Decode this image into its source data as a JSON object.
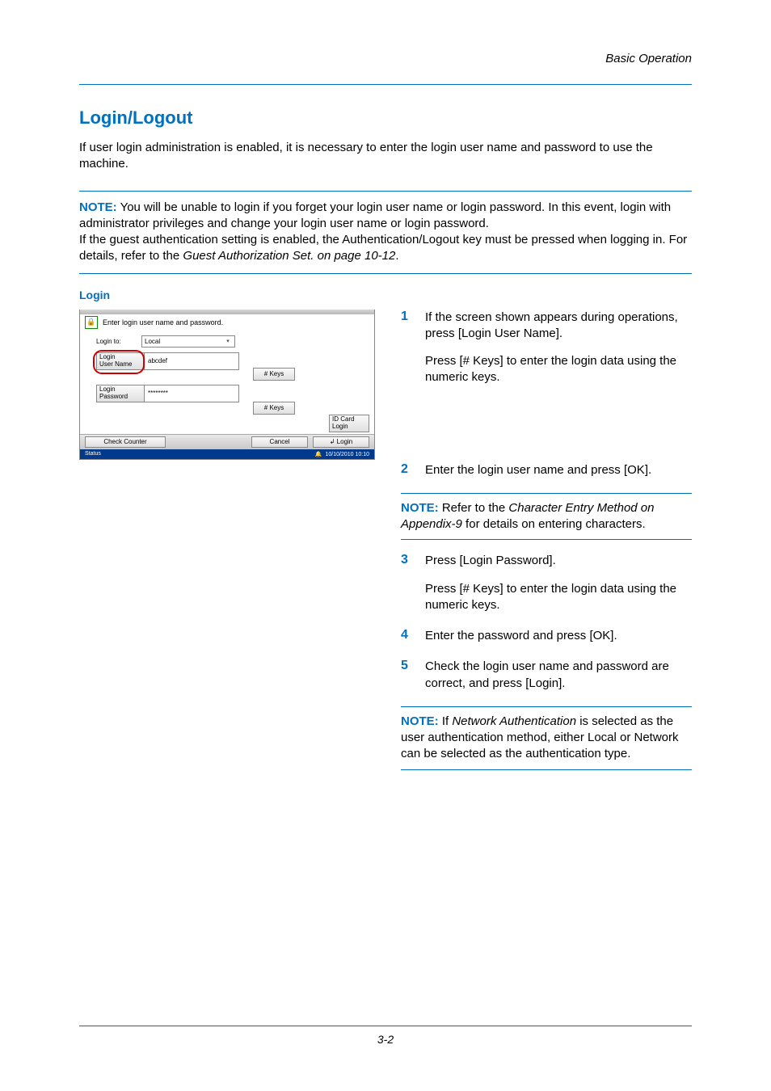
{
  "header": {
    "chapter": "Basic Operation"
  },
  "title": "Login/Logout",
  "intro": "If user login administration is enabled, it is necessary to enter the login user name and password to use the machine.",
  "note1": {
    "label": "NOTE:",
    "l1": " You will be unable to login if you forget your login user name or login password. In this event, login with administrator privileges and change your login user name or login password.",
    "l2a": "If the guest authentication setting is enabled, the Authentication/Logout key must be pressed when logging in. For details, refer to the ",
    "l2b": "Guest Authorization Set. on page 10-12",
    "l2c": "."
  },
  "subheading": "Login",
  "panel": {
    "title": "Enter login user name and password.",
    "login_to_label": "Login to:",
    "login_to_value": "Local",
    "uname_label": "Login\nUser Name",
    "uname_value": "abcdef",
    "pwd_label": "Login\nPassword",
    "pwd_value": "********",
    "keys_label": "# Keys",
    "idcard_label": "ID Card\nLogin",
    "check_counter": "Check Counter",
    "cancel": "Cancel",
    "login": "Login",
    "status": "Status",
    "datetime": "10/10/2010  10:10"
  },
  "steps": {
    "s1": {
      "n": "1",
      "a": "If the screen shown appears during operations, press [Login User Name].",
      "b": "Press [# Keys] to enter the login data using the numeric keys."
    },
    "s2": {
      "n": "2",
      "a": "Enter the login user name and press [OK]."
    },
    "note2": {
      "label": "NOTE:",
      "a": " Refer to the ",
      "b": "Character Entry Method on Appendix-9",
      "c": " for details on entering characters."
    },
    "s3": {
      "n": "3",
      "a": "Press [Login Password].",
      "b": "Press [# Keys] to enter the login data using the numeric keys."
    },
    "s4": {
      "n": "4",
      "a": "Enter the password and press [OK]."
    },
    "s5": {
      "n": "5",
      "a": "Check the login user name and password are correct, and press [Login]."
    },
    "note3": {
      "label": "NOTE:",
      "a": " If ",
      "b": "Network Authentication",
      "c": " is selected as the user authentication method, either Local or Network can be selected as the authentication type."
    }
  },
  "footer": {
    "page": "3-2"
  }
}
